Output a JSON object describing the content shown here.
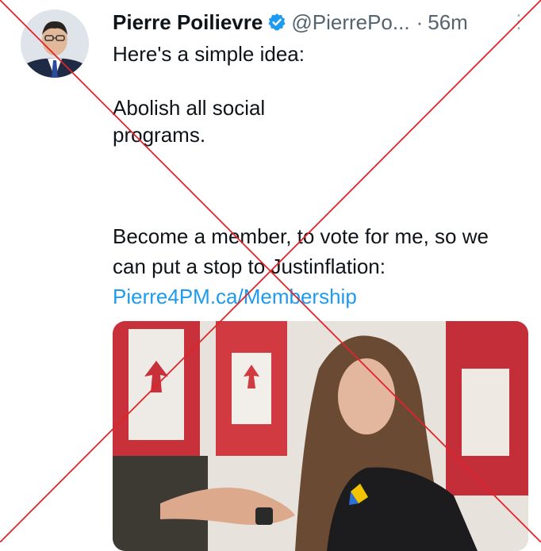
{
  "tweet": {
    "author_name": "Pierre Poilievre",
    "handle": "@PierrePo...",
    "separator": "·",
    "timestamp": "56m",
    "more_label": "⋮",
    "line1": "Here's a simple idea:",
    "line2": "Abolish all social",
    "line3": "programs.",
    "line4": "Become a member, to vote for me, so we",
    "line5": "can put a stop to Justinflation:",
    "link": "Pierre4PM.ca/Membership"
  },
  "colors": {
    "link": "#1d9bf0",
    "verified": "#1d9bf0",
    "muted": "#536471",
    "cross": "#e0242a"
  },
  "icons": {
    "verified": "verified-badge-icon",
    "more": "more-options-icon"
  }
}
